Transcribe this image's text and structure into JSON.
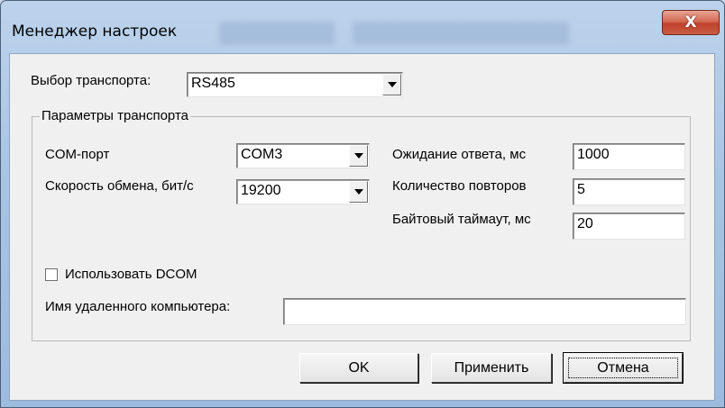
{
  "window": {
    "title": "Менеджер настроек",
    "close_glyph": "X"
  },
  "transport": {
    "label": "Выбор транспорта:",
    "value": "RS485"
  },
  "params": {
    "group_title": "Параметры транспорта",
    "com_port": {
      "label": "COM-порт",
      "value": "COM3"
    },
    "speed": {
      "label": "Скорость обмена, бит/с",
      "value": "19200"
    },
    "timeout": {
      "label": "Ожидание ответа, мс",
      "value": "1000"
    },
    "retries": {
      "label": "Количество повторов",
      "value": "5"
    },
    "byte_timeout": {
      "label": "Байтовый таймаут, мс",
      "value": "20"
    },
    "dcom": {
      "label": "Использовать DCOM",
      "checked": false
    },
    "remote": {
      "label": "Имя удаленного компьютера:",
      "value": ""
    }
  },
  "buttons": {
    "ok": "OK",
    "apply": "Применить",
    "cancel": "Отмена"
  },
  "colors": {
    "frame": "#a8c4e3",
    "close": "#c0422c",
    "dialog_bg": "#f0f0f0"
  }
}
